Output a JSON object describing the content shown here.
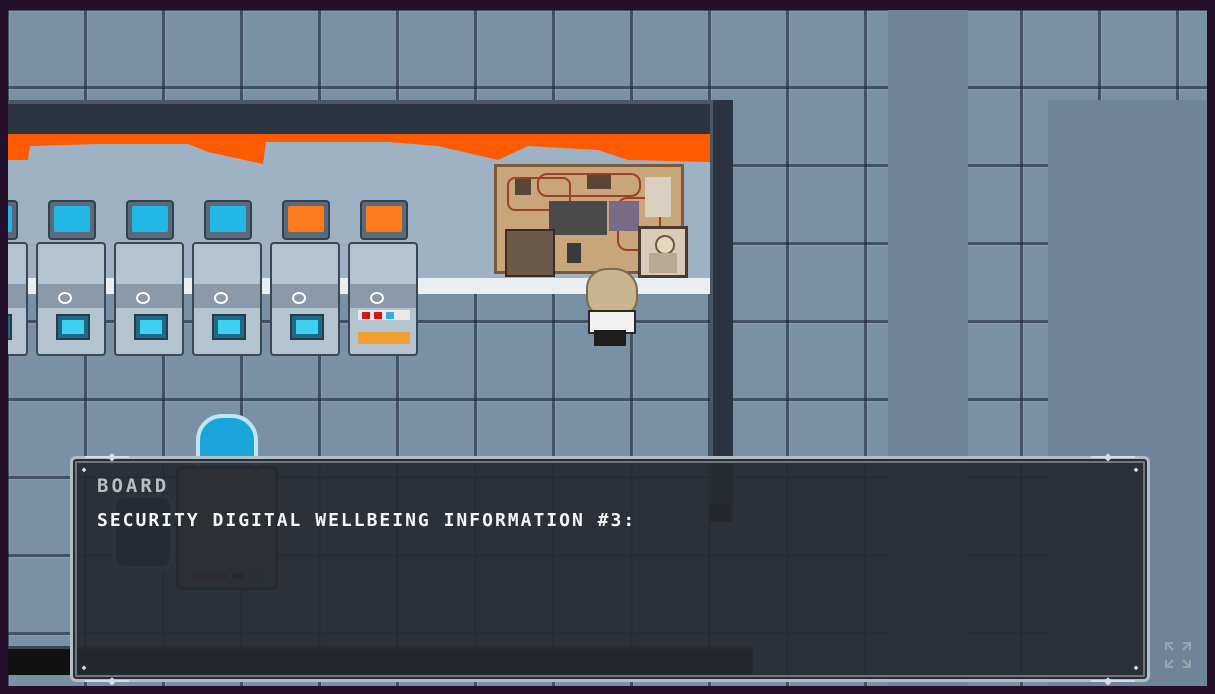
{
  "dialogue": {
    "speaker": "Board",
    "message": "Security Digital Wellbeing Information #3:"
  },
  "controls": {
    "fullscreen_icon": "expand-arrows-icon"
  },
  "scene": {
    "palette": {
      "floor": "#7a90a4",
      "wall": "#2b3440",
      "warning_stripe": "#ff5a00",
      "screen_blue": "#22b8e6",
      "screen_orange": "#ff7a1a",
      "dialog_bg": "#262a30",
      "dialog_border": "#b4bcc4"
    },
    "consoles": [
      {
        "screen": "blue"
      },
      {
        "screen": "blue"
      },
      {
        "screen": "blue"
      },
      {
        "screen": "orange"
      },
      {
        "screen": "orange"
      }
    ]
  }
}
